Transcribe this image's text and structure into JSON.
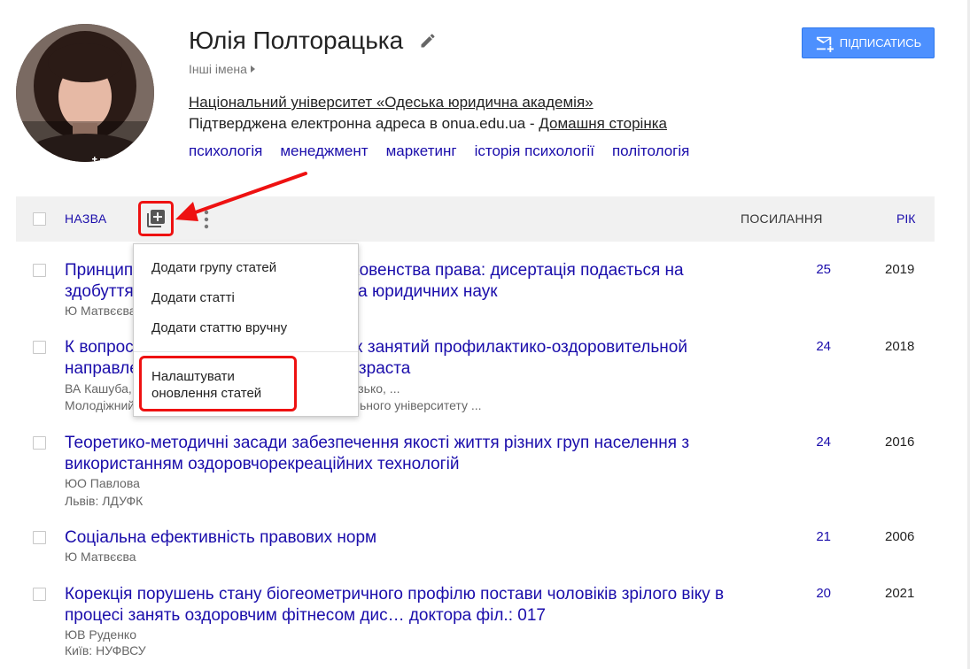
{
  "profile": {
    "name": "Юлія Полторацька",
    "other_names": "Інші імена",
    "affiliation": "Національний університет «Одеська юридична академія»",
    "verified_email": "Підтверджена електронна адреса в onua.edu.ua - ",
    "homepage": "Домашня сторінка",
    "interests": [
      "психологія",
      "менеджмент",
      "маркетинг",
      "історія психології",
      "політологія"
    ]
  },
  "subscribe_label": "ПІДПИСАТИСЬ",
  "table": {
    "col_title": "НАЗВА",
    "col_cites": "ПОСИЛАННЯ",
    "col_year": "РІК"
  },
  "menu": {
    "items": [
      "Додати групу статей",
      "Додати статті",
      "Додати статтю вручну"
    ],
    "settings_line1": "Налаштувати",
    "settings_line2": "оновлення статей"
  },
  "rows": [
    {
      "title": "Принципи і правила як складова верховенства права: дисертація подається на здобуття наукового ступеня кандидата юридичних наук",
      "authors": "Ю Матвєєва",
      "pub": "",
      "cites": "25",
      "year": "2019"
    },
    {
      "title": "К вопросу о влиянии систематических занятий профилактико-оздоровительной направленности на людей зрелого возраста",
      "authors": "ВА Кашуба, ЮВ Полторацкая, ЮВ Руденко, ОО Лазько, ...",
      "pub": "Молодіжний науковий вісник Волинського національного університету ...",
      "cites": "24",
      "year": "2018"
    },
    {
      "title": "Теоретико-методичні засади забезпечення якості життя різних груп населення з використанням оздоровчорекреаційних технологій",
      "authors": "ЮО Павлова",
      "pub": "Львів: ЛДУФК",
      "cites": "24",
      "year": "2016"
    },
    {
      "title": "Соціальна ефективність правових норм",
      "authors": "Ю Матвєєва",
      "pub": "",
      "cites": "21",
      "year": "2006"
    },
    {
      "title": "Корекція порушень стану біогеометричного профілю постави чоловіків зрілого віку в процесі занять оздоровчим фітнесом дис… доктора філ.: 017",
      "authors": "ЮВ Руденко",
      "pub": "Київ: НУФВСУ",
      "cites": "20",
      "year": "2021"
    }
  ],
  "colors": {
    "link": "#1a0dab",
    "accent": "#4d90fe",
    "highlight": "#e11111"
  }
}
